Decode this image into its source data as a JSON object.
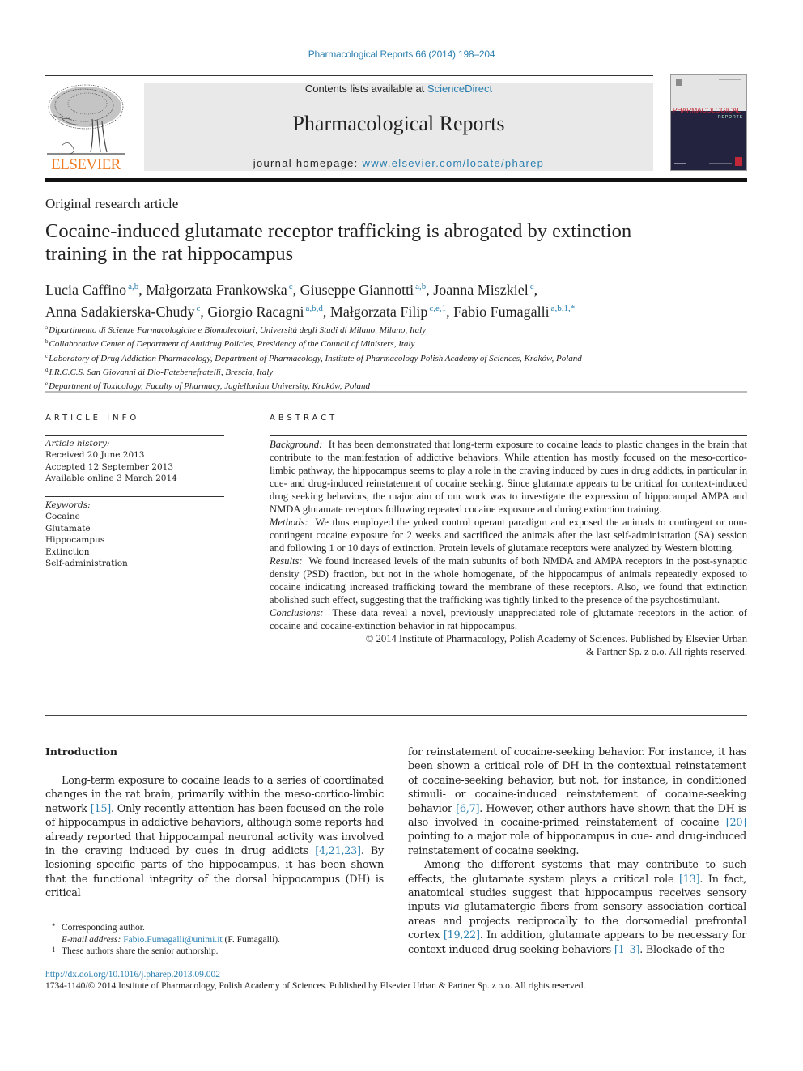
{
  "header": {
    "citation": "Pharmacological Reports 66 (2014) 198–204",
    "contents_prefix": "Contents lists available at ",
    "contents_link": "ScienceDirect",
    "journal_title": "Pharmacological Reports",
    "homepage_prefix": "journal homepage: ",
    "homepage_link": "www.elsevier.com/locate/pharep",
    "publisher_logo_text": "ELSEVIER",
    "publisher_logo_icon": "tree-icon",
    "cover": {
      "title": "PHARMACOLOGICAL",
      "subtitle": "REPORTS",
      "colors": {
        "top": "#e4e4e4",
        "bottom": "#23223f",
        "title": "#c0283a"
      }
    }
  },
  "article": {
    "type": "Original research article",
    "title_line1": "Cocaine-induced glutamate receptor trafficking is abrogated by extinction",
    "title_line2": "training in the rat hippocampus",
    "authors": [
      {
        "name": "Lucia Caffino",
        "sup": "a,b",
        "sep": ", "
      },
      {
        "name": "Małgorzata Frankowska",
        "sup": "c",
        "sep": ", "
      },
      {
        "name": "Giuseppe Giannotti",
        "sup": "a,b",
        "sep": ", "
      },
      {
        "name": "Joanna Miszkiel",
        "sup": "c",
        "sep": ","
      },
      {
        "name": "Anna Sadakierska-Chudy",
        "sup": "c",
        "sep": ", "
      },
      {
        "name": "Giorgio Racagni",
        "sup": "a,b,d",
        "sep": ", "
      },
      {
        "name": "Małgorzata Filip",
        "sup": "c,e,1",
        "sep": ", "
      },
      {
        "name": "Fabio Fumagalli",
        "sup": "a,b,1,*",
        "sep": ""
      }
    ],
    "affiliations": [
      {
        "key": "a",
        "text": "Dipartimento di Scienze Farmacologiche e Biomolecolari, Università degli Studi di Milano, Milano, Italy"
      },
      {
        "key": "b",
        "text": "Collaborative Center of Department of Antidrug Policies, Presidency of the Council of Ministers, Italy"
      },
      {
        "key": "c",
        "text": "Laboratory of Drug Addiction Pharmacology, Department of Pharmacology, Institute of Pharmacology Polish Academy of Sciences, Kraków, Poland"
      },
      {
        "key": "d",
        "text": "I.R.C.C.S. San Giovanni di Dio-Fatebenefratelli, Brescia, Italy"
      },
      {
        "key": "e",
        "text": "Department of Toxicology, Faculty of Pharmacy, Jagiellonian University, Kraków, Poland"
      }
    ]
  },
  "article_info": {
    "heading": "ARTICLE INFO",
    "history_label": "Article history:",
    "history": [
      "Received 20 June 2013",
      "Accepted 12 September 2013",
      "Available online 3 March 2014"
    ],
    "keywords_label": "Keywords:",
    "keywords": [
      "Cocaine",
      "Glutamate",
      "Hippocampus",
      "Extinction",
      "Self-administration"
    ]
  },
  "abstract": {
    "heading": "ABSTRACT",
    "sections": [
      {
        "label": "Background:",
        "text": "It has been demonstrated that long-term exposure to cocaine leads to plastic changes in the brain that contribute to the manifestation of addictive behaviors. While attention has mostly focused on the meso-cortico-limbic pathway, the hippocampus seems to play a role in the craving induced by cues in drug addicts, in particular in cue- and drug-induced reinstatement of cocaine seeking. Since glutamate appears to be critical for context-induced drug seeking behaviors, the major aim of our work was to investigate the expression of hippocampal AMPA and NMDA glutamate receptors following repeated cocaine exposure and during extinction training."
      },
      {
        "label": "Methods:",
        "text": "We thus employed the yoked control operant paradigm and exposed the animals to contingent or non-contingent cocaine exposure for 2 weeks and sacrificed the animals after the last self-administration (SA) session and following 1 or 10 days of extinction. Protein levels of glutamate receptors were analyzed by Western blotting."
      },
      {
        "label": "Results:",
        "text": "We found increased levels of the main subunits of both NMDA and AMPA receptors in the post-synaptic density (PSD) fraction, but not in the whole homogenate, of the hippocampus of animals repeatedly exposed to cocaine indicating increased trafficking toward the membrane of these receptors. Also, we found that extinction abolished such effect, suggesting that the trafficking was tightly linked to the presence of the psychostimulant."
      },
      {
        "label": "Conclusions:",
        "text": "These data reveal a novel, previously unappreciated role of glutamate receptors in the action of cocaine and cocaine-extinction behavior in rat hippocampus."
      }
    ],
    "copyright_line1": "© 2014 Institute of Pharmacology, Polish Academy of Sciences. Published by Elsevier Urban",
    "copyright_line2": "& Partner Sp. z o.o. All rights reserved."
  },
  "body": {
    "intro_heading": "Introduction",
    "left_para": [
      {
        "t": "Long-term exposure to cocaine leads to a series of coordinated changes in the rat brain, primarily within the meso-cortico-limbic network "
      },
      {
        "c": "[15]"
      },
      {
        "t": ". Only recently attention has been focused on the role of hippocampus in addictive behaviors, although some reports had already reported that hippocampal neuronal activity was involved in the craving induced by cues in drug addicts "
      },
      {
        "c": "[4,21,23]"
      },
      {
        "t": ". By lesioning specific parts of the hippocampus, it has been shown that the functional integrity of the dorsal hippocampus (DH) is critical"
      }
    ],
    "right_para1": [
      {
        "t": "for reinstatement of cocaine-seeking behavior. For instance, it has been shown a critical role of DH in the contextual reinstatement of cocaine-seeking behavior, but not, for instance, in conditioned stimuli- or cocaine-induced reinstatement of cocaine-seeking behavior "
      },
      {
        "c": "[6,7]"
      },
      {
        "t": ". However, other authors have shown that the DH is also involved in cocaine-primed reinstatement of cocaine "
      },
      {
        "c": "[20]"
      },
      {
        "t": " pointing to a major role of hippocampus in cue- and drug-induced reinstatement of cocaine seeking."
      }
    ],
    "right_para2": [
      {
        "t": "Among the different systems that may contribute to such effects, the glutamate system plays a critical role "
      },
      {
        "c": "[13]"
      },
      {
        "t": ". In fact, anatomical studies suggest that hippocampus receives sensory inputs "
      },
      {
        "i": "via"
      },
      {
        "t": " glutamatergic fibers from sensory association cortical areas and projects reciprocally to the dorsomedial prefrontal cortex "
      },
      {
        "c": "[19,22]"
      },
      {
        "t": ". In addition, glutamate appears to be necessary for context-induced drug seeking behaviors "
      },
      {
        "c": "[1–3]"
      },
      {
        "t": ". Blockade of the"
      }
    ]
  },
  "footnotes": {
    "corresponding_mark": "*",
    "corresponding": "Corresponding author.",
    "email_label": "E-mail address:",
    "email": "Fabio.Fumagalli@unimi.it",
    "email_suffix": " (F. Fumagalli).",
    "shared_mark": "1",
    "shared": "These authors share the senior authorship.",
    "doi": "http://dx.doi.org/10.1016/j.pharep.2013.09.002",
    "issn": "1734-1140/© 2014 Institute of Pharmacology, Polish Academy of Sciences. Published by Elsevier Urban & Partner Sp. z o.o. All rights reserved."
  }
}
